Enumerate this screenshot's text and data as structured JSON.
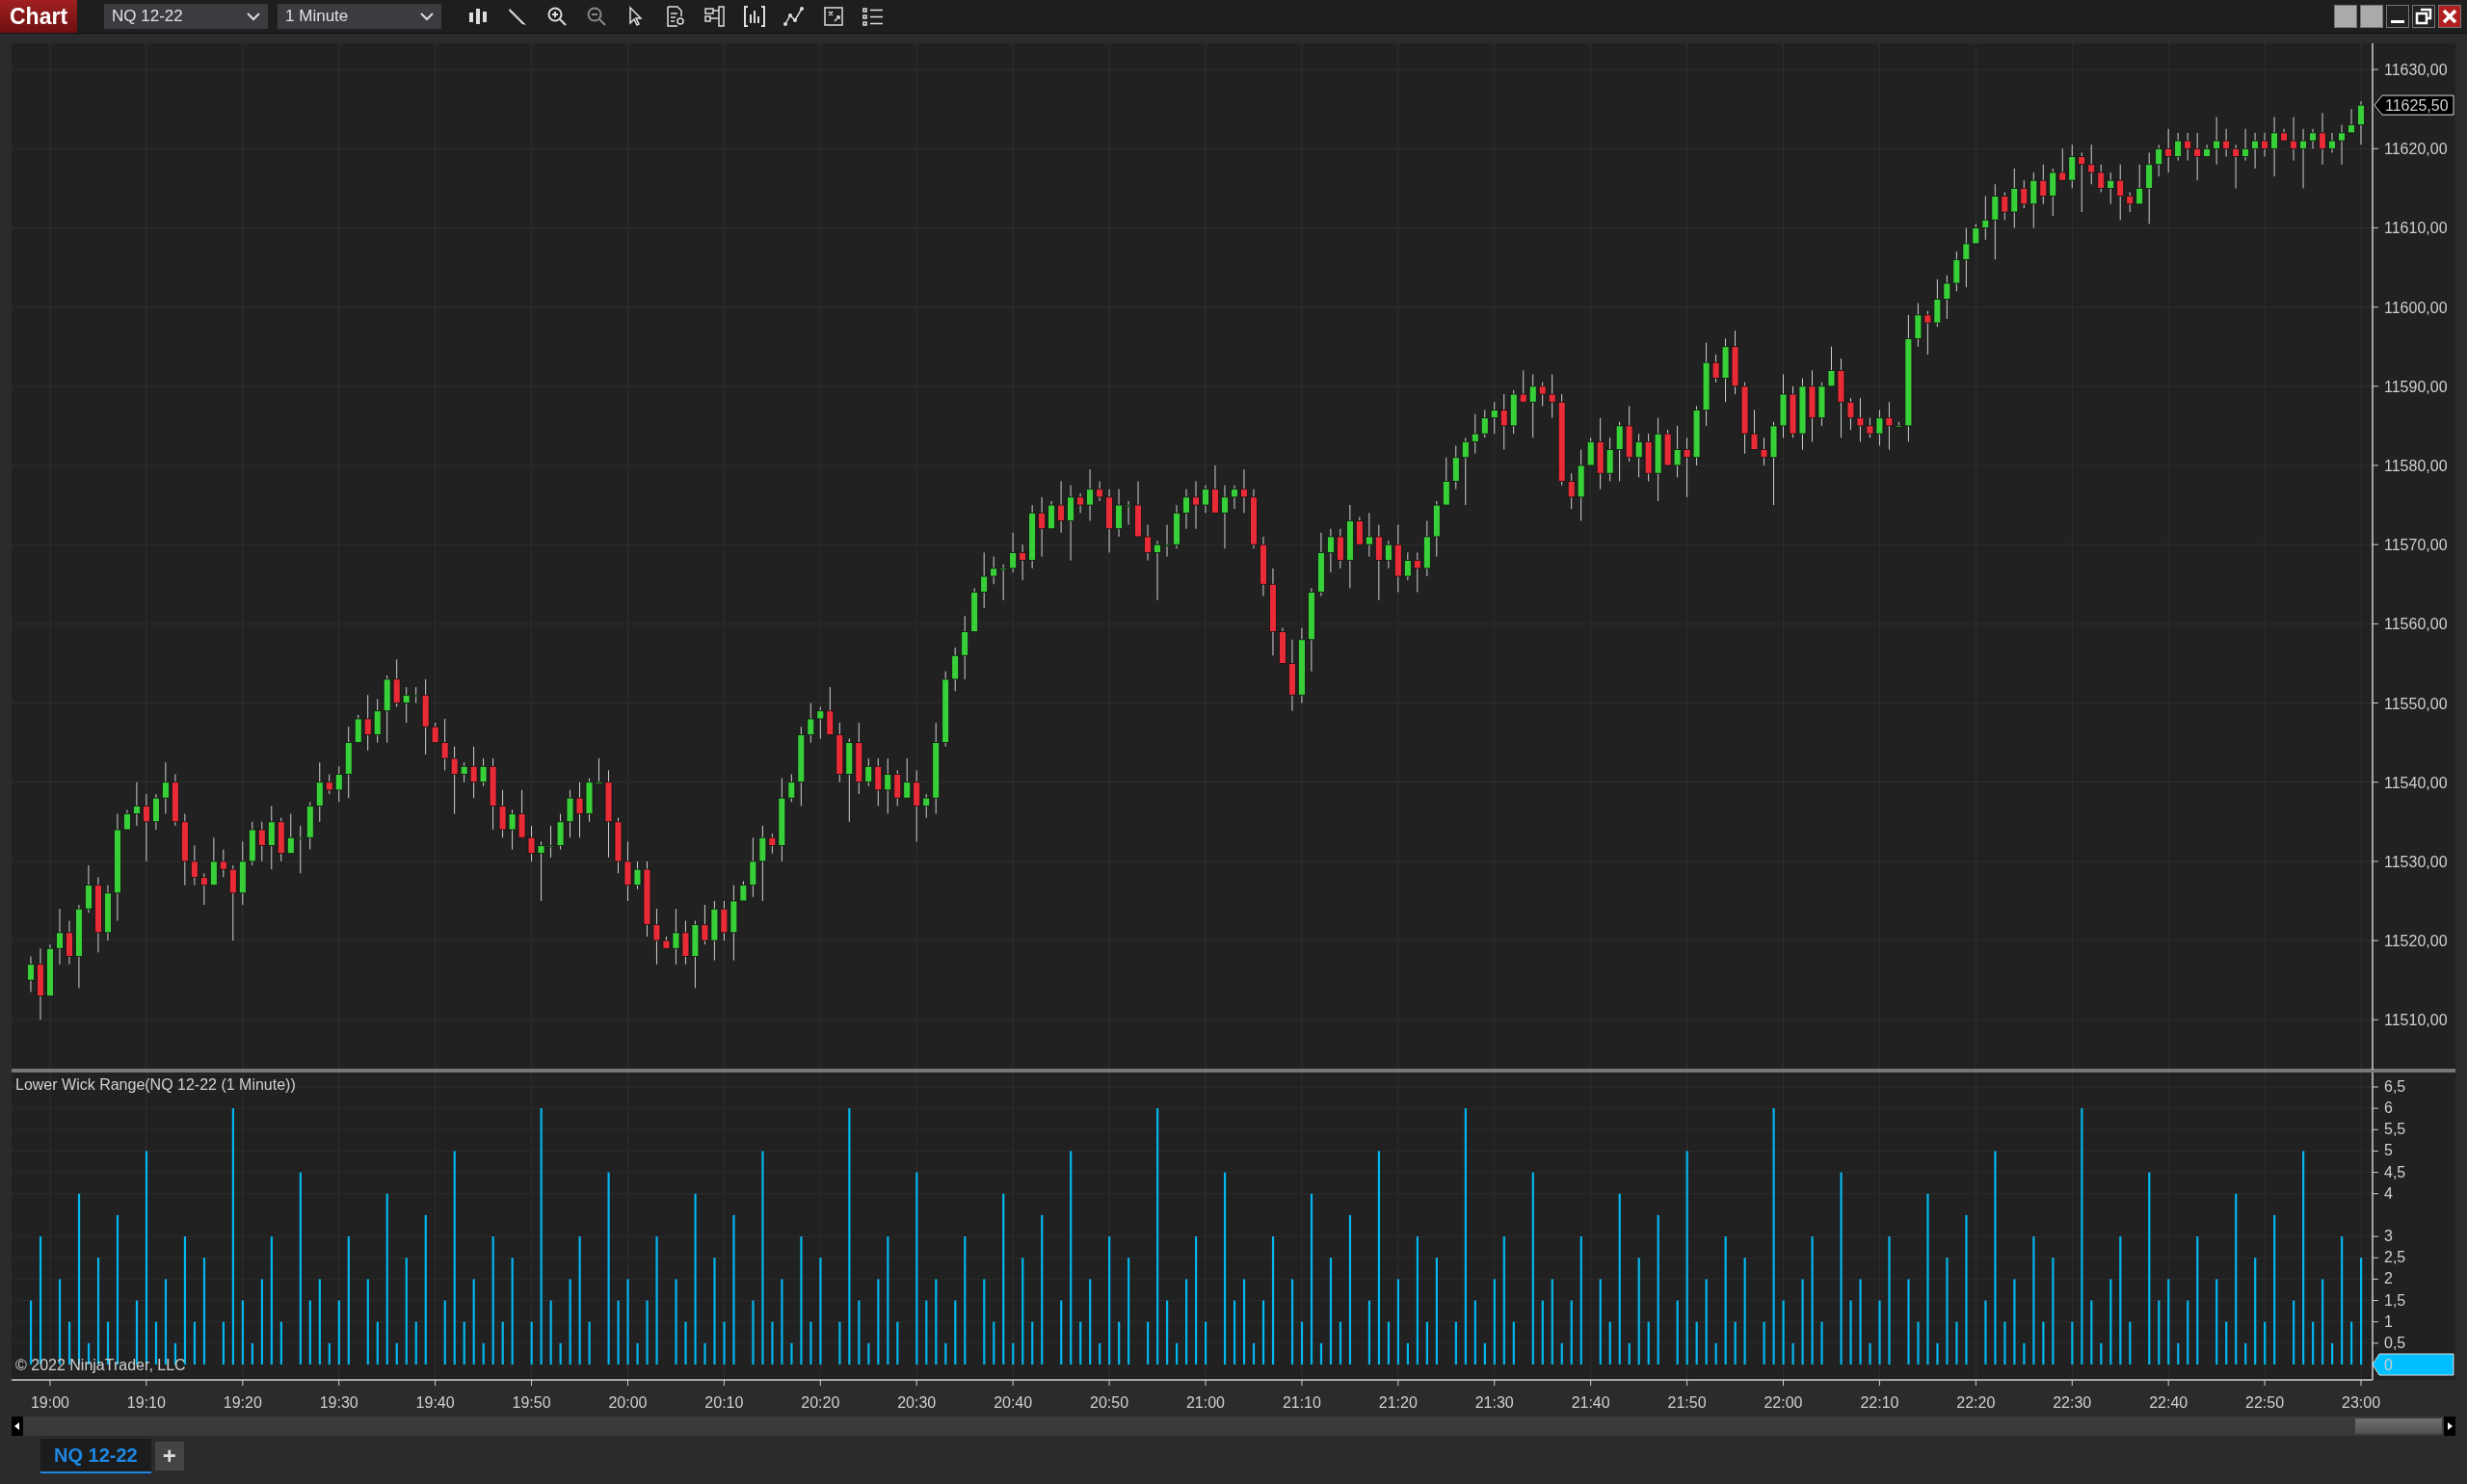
{
  "window": {
    "title": "Chart"
  },
  "toolbar": {
    "instrument": "NQ 12-22",
    "interval": "1 Minute"
  },
  "price_panel": {
    "chart_data": {
      "type": "candlestick",
      "categories": [
        null,
        null,
        null,
        null,
        null,
        null,
        null,
        null,
        null,
        null,
        null,
        null,
        null,
        null,
        null,
        null,
        null,
        null,
        null,
        null,
        null,
        null,
        null,
        null,
        null,
        null,
        null,
        null,
        null,
        null,
        null,
        null,
        null,
        null,
        null,
        null,
        null,
        null,
        null,
        null,
        null,
        null,
        null,
        null,
        null,
        null,
        null,
        null,
        null,
        null,
        null,
        null,
        null,
        null,
        null,
        null,
        null,
        null,
        null,
        null,
        null,
        null,
        null,
        null,
        null,
        null,
        null,
        null,
        null,
        null,
        null,
        null,
        null,
        null,
        null,
        null,
        null,
        null,
        null,
        null,
        null,
        null,
        null,
        null,
        null,
        null,
        null,
        null,
        null,
        null,
        null,
        null,
        null,
        null,
        null,
        null,
        null,
        null,
        null,
        null,
        null,
        null,
        null,
        null,
        null,
        null,
        null,
        null,
        null,
        null,
        null,
        null,
        null,
        null,
        null,
        null,
        null,
        null,
        null,
        null,
        null,
        null,
        null,
        null,
        null,
        null,
        null,
        null,
        null,
        null,
        null,
        null,
        null,
        null,
        null,
        null,
        null,
        null,
        null,
        null,
        null,
        null,
        null,
        null,
        null,
        null,
        null,
        null,
        null,
        null,
        null,
        null,
        null,
        null,
        null,
        null,
        null,
        null,
        null,
        null,
        null,
        null,
        null,
        null,
        null,
        null,
        null,
        null,
        null,
        null,
        null,
        null,
        null,
        null,
        null,
        null,
        null,
        null,
        null,
        null,
        null,
        null,
        null,
        null,
        null,
        null,
        null,
        null,
        null,
        null,
        null,
        null,
        null,
        null,
        null,
        null,
        null,
        null,
        null,
        null,
        null,
        null,
        null,
        null,
        null,
        null,
        null,
        null,
        null,
        null,
        null,
        null,
        null,
        null,
        null,
        null,
        null,
        null,
        null,
        null,
        null,
        null,
        null,
        null,
        null,
        null,
        null,
        null,
        null,
        null,
        null,
        null,
        null,
        null,
        null,
        null,
        null,
        null,
        null,
        null,
        null,
        null,
        null
      ],
      "ohlc": [
        [
          11515,
          11518,
          11513.5,
          11517
        ],
        [
          11517,
          11519,
          11510,
          11513
        ],
        [
          11513,
          11519.5,
          11513,
          11519
        ],
        [
          11519,
          11524,
          11517,
          11521
        ],
        [
          11521,
          11522.5,
          11517,
          11518
        ],
        [
          11518,
          11524.5,
          11514,
          11524
        ],
        [
          11524,
          11529.5,
          11523.5,
          11527
        ],
        [
          11527,
          11528,
          11518.5,
          11521
        ],
        [
          11521,
          11527,
          11520,
          11526
        ],
        [
          11526,
          11536,
          11522.5,
          11534
        ],
        [
          11534,
          11536.5,
          11534,
          11536
        ],
        [
          11536,
          11540,
          11534.5,
          11537
        ],
        [
          11537,
          11538.5,
          11530,
          11535
        ],
        [
          11535,
          11538.5,
          11534,
          11538
        ],
        [
          11538,
          11542.5,
          11536,
          11540
        ],
        [
          11540,
          11541,
          11534.5,
          11535
        ],
        [
          11535,
          11536,
          11527,
          11530
        ],
        [
          11530,
          11532,
          11527,
          11528
        ],
        [
          11528,
          11528.5,
          11524.5,
          11527
        ],
        [
          11527,
          11533,
          11527,
          11530
        ],
        [
          11530,
          11531.5,
          11528,
          11529
        ],
        [
          11529,
          11529.5,
          11520,
          11526
        ],
        [
          11526,
          11532.5,
          11524.5,
          11530
        ],
        [
          11530,
          11535,
          11529.5,
          11534
        ],
        [
          11534,
          11535,
          11530,
          11532
        ],
        [
          11532,
          11537,
          11529,
          11535
        ],
        [
          11535,
          11535.5,
          11530,
          11531
        ],
        [
          11531,
          11536,
          11531,
          11533
        ],
        [
          11533,
          11534.5,
          11528.5,
          11533
        ],
        [
          11533,
          11537.5,
          11531.5,
          11537
        ],
        [
          11537,
          11542.5,
          11535,
          11540
        ],
        [
          11540,
          11541,
          11538.5,
          11539
        ],
        [
          11539,
          11542,
          11537.5,
          11541
        ],
        [
          11541,
          11547,
          11538,
          11545
        ],
        [
          11545,
          11548.5,
          11545,
          11548
        ],
        [
          11548,
          11551,
          11544,
          11546
        ],
        [
          11546,
          11550.5,
          11545,
          11549
        ],
        [
          11549,
          11553.5,
          11545,
          11553
        ],
        [
          11553,
          11555.5,
          11549.5,
          11550
        ],
        [
          11550,
          11552,
          11547.5,
          11551
        ],
        [
          11551,
          11552,
          11550,
          11551
        ],
        [
          11551,
          11553,
          11543.5,
          11547
        ],
        [
          11547,
          11547.5,
          11545,
          11545
        ],
        [
          11545,
          11548,
          11541.5,
          11543
        ],
        [
          11543,
          11544.5,
          11536,
          11541
        ],
        [
          11541,
          11542.5,
          11540,
          11542
        ],
        [
          11542,
          11544.5,
          11538,
          11540
        ],
        [
          11540,
          11543,
          11539.5,
          11542
        ],
        [
          11542,
          11543,
          11534,
          11537
        ],
        [
          11537,
          11539,
          11533,
          11534
        ],
        [
          11534,
          11536.5,
          11531.5,
          11536
        ],
        [
          11536,
          11539,
          11533,
          11533
        ],
        [
          11533,
          11534.5,
          11530,
          11531
        ],
        [
          11531,
          11532.5,
          11525,
          11532
        ],
        [
          11532,
          11534.5,
          11530.5,
          11532
        ],
        [
          11532,
          11536,
          11531.5,
          11535
        ],
        [
          11535,
          11539,
          11533,
          11538
        ],
        [
          11538,
          11540,
          11533,
          11536
        ],
        [
          11536,
          11540.5,
          11535,
          11540
        ],
        [
          11540,
          11543,
          11540,
          11540
        ],
        [
          11540,
          11541.5,
          11530.5,
          11535
        ],
        [
          11535,
          11535.5,
          11528.5,
          11530
        ],
        [
          11530,
          11532.5,
          11525,
          11527
        ],
        [
          11527,
          11530,
          11526.5,
          11529
        ],
        [
          11529,
          11530,
          11520.5,
          11522
        ],
        [
          11522,
          11524,
          11517,
          11520
        ],
        [
          11520,
          11520.5,
          11519,
          11519
        ],
        [
          11519,
          11524,
          11517,
          11521
        ],
        [
          11521,
          11522.5,
          11517,
          11518
        ],
        [
          11518,
          11522.5,
          11514,
          11522
        ],
        [
          11522,
          11524.5,
          11519.5,
          11520
        ],
        [
          11520,
          11525,
          11517.5,
          11524
        ],
        [
          11524,
          11525,
          11520,
          11521
        ],
        [
          11521,
          11527,
          11517.5,
          11525
        ],
        [
          11525,
          11527.5,
          11525,
          11527
        ],
        [
          11527,
          11533,
          11525.5,
          11530
        ],
        [
          11530,
          11534.5,
          11525,
          11533
        ],
        [
          11533,
          11533.5,
          11531,
          11532
        ],
        [
          11532,
          11540.5,
          11530,
          11538
        ],
        [
          11538,
          11541,
          11537.5,
          11540
        ],
        [
          11540,
          11547,
          11537,
          11546
        ],
        [
          11546,
          11550,
          11545,
          11548
        ],
        [
          11548,
          11549.5,
          11545.5,
          11549
        ],
        [
          11549,
          11552,
          11546,
          11546
        ],
        [
          11546,
          11547.5,
          11540,
          11541
        ],
        [
          11541,
          11545.5,
          11535,
          11545
        ],
        [
          11545,
          11547.5,
          11538.5,
          11540
        ],
        [
          11540,
          11543,
          11539.5,
          11542
        ],
        [
          11542,
          11543,
          11537,
          11539
        ],
        [
          11539,
          11543,
          11536,
          11541
        ],
        [
          11541,
          11541.5,
          11537,
          11538
        ],
        [
          11538,
          11543,
          11538,
          11540
        ],
        [
          11540,
          11541.5,
          11532.5,
          11537
        ],
        [
          11537,
          11538.5,
          11535.5,
          11538
        ],
        [
          11538,
          11547.5,
          11536,
          11545
        ],
        [
          11545,
          11554,
          11544.5,
          11553
        ],
        [
          11553,
          11557,
          11551.5,
          11556
        ],
        [
          11556,
          11561,
          11553,
          11559
        ],
        [
          11559,
          11564.5,
          11559,
          11564
        ],
        [
          11564,
          11569,
          11562,
          11566
        ],
        [
          11566,
          11568.5,
          11565,
          11567
        ],
        [
          11567,
          11567.5,
          11563,
          11567
        ],
        [
          11567,
          11571.5,
          11566.5,
          11569
        ],
        [
          11569,
          11570,
          11565.5,
          11568
        ],
        [
          11568,
          11575,
          11567,
          11574
        ],
        [
          11574,
          11576,
          11568.5,
          11572
        ],
        [
          11572,
          11575.5,
          11572,
          11575
        ],
        [
          11575,
          11578,
          11571.5,
          11573
        ],
        [
          11573,
          11577.5,
          11568,
          11576
        ],
        [
          11576,
          11576.5,
          11574,
          11575
        ],
        [
          11575,
          11579.5,
          11573,
          11577
        ],
        [
          11577,
          11578,
          11575.5,
          11576
        ],
        [
          11576,
          11577,
          11569,
          11572
        ],
        [
          11572,
          11577,
          11571,
          11575
        ],
        [
          11575,
          11575.5,
          11572.5,
          11575
        ],
        [
          11575,
          11578,
          11571,
          11571
        ],
        [
          11571,
          11572.5,
          11568,
          11569
        ],
        [
          11569,
          11570.5,
          11563,
          11570
        ],
        [
          11570,
          11572.5,
          11568.5,
          11570
        ],
        [
          11570,
          11575,
          11569.5,
          11574
        ],
        [
          11574,
          11577,
          11572,
          11576
        ],
        [
          11576,
          11578,
          11572,
          11575
        ],
        [
          11575,
          11577.5,
          11574,
          11577
        ],
        [
          11577,
          11580,
          11574,
          11574
        ],
        [
          11574,
          11577.5,
          11569.5,
          11576
        ],
        [
          11576,
          11577.5,
          11574.5,
          11577
        ],
        [
          11577,
          11579.5,
          11574,
          11576
        ],
        [
          11576,
          11577,
          11569.5,
          11570
        ],
        [
          11570,
          11571,
          11563.5,
          11565
        ],
        [
          11565,
          11567,
          11556,
          11559
        ],
        [
          11559,
          11559.5,
          11555,
          11555
        ],
        [
          11555,
          11558,
          11549,
          11551
        ],
        [
          11551,
          11559.5,
          11550,
          11558
        ],
        [
          11558,
          11564.5,
          11554,
          11564
        ],
        [
          11564,
          11571.5,
          11563.5,
          11569
        ],
        [
          11569,
          11572,
          11566.5,
          11571
        ],
        [
          11571,
          11572,
          11567,
          11568
        ],
        [
          11568,
          11575,
          11564.5,
          11573
        ],
        [
          11573,
          11573.5,
          11570,
          11570
        ],
        [
          11570,
          11574,
          11568.5,
          11571
        ],
        [
          11571,
          11572.5,
          11563,
          11568
        ],
        [
          11568,
          11570.5,
          11567,
          11570
        ],
        [
          11570,
          11572.5,
          11564,
          11566
        ],
        [
          11566,
          11569,
          11565.5,
          11568
        ],
        [
          11568,
          11569,
          11564,
          11567
        ],
        [
          11567,
          11573,
          11566,
          11571
        ],
        [
          11571,
          11575.5,
          11568.5,
          11575
        ],
        [
          11575,
          11581,
          11575,
          11578
        ],
        [
          11578,
          11582.5,
          11577,
          11581
        ],
        [
          11581,
          11583.5,
          11575,
          11583
        ],
        [
          11583,
          11586.5,
          11581.5,
          11584
        ],
        [
          11584,
          11587,
          11583.5,
          11586
        ],
        [
          11586,
          11588,
          11584,
          11587
        ],
        [
          11587,
          11589,
          11582,
          11585
        ],
        [
          11585,
          11589.5,
          11584,
          11589
        ],
        [
          11589,
          11592,
          11588,
          11588
        ],
        [
          11588,
          11591.5,
          11583.5,
          11590
        ],
        [
          11590,
          11590.5,
          11587.5,
          11589
        ],
        [
          11589,
          11591.5,
          11586,
          11588
        ],
        [
          11588,
          11589,
          11577.5,
          11578
        ],
        [
          11578,
          11579,
          11574.5,
          11576
        ],
        [
          11576,
          11582,
          11573,
          11580
        ],
        [
          11580,
          11583.5,
          11580,
          11583
        ],
        [
          11583,
          11586,
          11577,
          11579
        ],
        [
          11579,
          11583.5,
          11578,
          11582
        ],
        [
          11582,
          11585.5,
          11578,
          11585
        ],
        [
          11585,
          11587.5,
          11580.5,
          11581
        ],
        [
          11581,
          11584,
          11578.5,
          11583
        ],
        [
          11583,
          11584,
          11578,
          11579
        ],
        [
          11579,
          11586,
          11575.5,
          11584
        ],
        [
          11584,
          11584.5,
          11580,
          11580
        ],
        [
          11580,
          11585,
          11578.5,
          11582
        ],
        [
          11582,
          11583.5,
          11576,
          11581
        ],
        [
          11581,
          11587.5,
          11580,
          11587
        ],
        [
          11587,
          11595.5,
          11585,
          11593
        ],
        [
          11593,
          11594,
          11590.5,
          11591
        ],
        [
          11591,
          11596,
          11588,
          11595
        ],
        [
          11595,
          11597,
          11589,
          11590
        ],
        [
          11590,
          11590.5,
          11581.5,
          11584
        ],
        [
          11584,
          11587,
          11582,
          11582
        ],
        [
          11582,
          11583.5,
          11580,
          11581
        ],
        [
          11581,
          11585.5,
          11575,
          11585
        ],
        [
          11585,
          11591.5,
          11583.5,
          11589
        ],
        [
          11589,
          11590,
          11583.5,
          11584
        ],
        [
          11584,
          11591,
          11582,
          11590
        ],
        [
          11590,
          11592,
          11583,
          11586
        ],
        [
          11586,
          11590.5,
          11585,
          11590
        ],
        [
          11590,
          11595,
          11590,
          11592
        ],
        [
          11592,
          11593.5,
          11583.5,
          11588
        ],
        [
          11588,
          11588.5,
          11584.5,
          11586
        ],
        [
          11586,
          11588.5,
          11583,
          11585
        ],
        [
          11585,
          11586,
          11583.5,
          11584
        ],
        [
          11584,
          11587,
          11582.5,
          11586
        ],
        [
          11586,
          11588,
          11582,
          11585
        ],
        [
          11585,
          11585.5,
          11585,
          11585
        ],
        [
          11585,
          11599,
          11583,
          11596
        ],
        [
          11596,
          11600.5,
          11595,
          11599
        ],
        [
          11599,
          11599.5,
          11594,
          11598
        ],
        [
          11598,
          11603.5,
          11597.5,
          11601
        ],
        [
          11601,
          11604,
          11598.5,
          11603
        ],
        [
          11603,
          11607,
          11602,
          11606
        ],
        [
          11606,
          11610,
          11602.5,
          11608
        ],
        [
          11608,
          11610.5,
          11608,
          11610
        ],
        [
          11610,
          11614,
          11608.5,
          11611
        ],
        [
          11611,
          11615.5,
          11606,
          11614
        ],
        [
          11614,
          11614.5,
          11611,
          11612
        ],
        [
          11612,
          11617.5,
          11610,
          11615
        ],
        [
          11615,
          11616,
          11612.5,
          11613
        ],
        [
          11613,
          11617,
          11610,
          11616
        ],
        [
          11616,
          11618,
          11613,
          11614
        ],
        [
          11614,
          11617.5,
          11611.5,
          11617
        ],
        [
          11617,
          11620,
          11616,
          11616
        ],
        [
          11616,
          11620.5,
          11615,
          11619
        ],
        [
          11619,
          11619.5,
          11612,
          11618
        ],
        [
          11618,
          11620.5,
          11615.5,
          11617
        ],
        [
          11617,
          11618,
          11614.5,
          11615
        ],
        [
          11615,
          11617,
          11613,
          11616
        ],
        [
          11616,
          11618,
          11611,
          11614
        ],
        [
          11614,
          11614.5,
          11612,
          11613
        ],
        [
          11613,
          11618,
          11613,
          11615
        ],
        [
          11615,
          11619.5,
          11610.5,
          11618
        ],
        [
          11618,
          11620.5,
          11616.5,
          11620
        ],
        [
          11620,
          11622.5,
          11617,
          11619
        ],
        [
          11619,
          11622,
          11618.5,
          11621
        ],
        [
          11621,
          11622,
          11618.5,
          11620
        ],
        [
          11620,
          11622,
          11616,
          11619
        ],
        [
          11619,
          11620.5,
          11619,
          11620
        ],
        [
          11620,
          11624,
          11618,
          11621
        ],
        [
          11621,
          11622.5,
          11619,
          11620
        ],
        [
          11620,
          11620.5,
          11615,
          11619
        ],
        [
          11619,
          11622.5,
          11618.5,
          11620
        ],
        [
          11620,
          11622,
          11617.5,
          11621
        ],
        [
          11621,
          11622,
          11619,
          11620
        ],
        [
          11620,
          11624,
          11616.5,
          11622
        ],
        [
          11622,
          11622.5,
          11621,
          11621
        ],
        [
          11621,
          11624,
          11618.5,
          11620
        ],
        [
          11620,
          11622.5,
          11615,
          11621
        ],
        [
          11621,
          11622.5,
          11620,
          11622
        ],
        [
          11622,
          11624.5,
          11618,
          11620
        ],
        [
          11620,
          11622,
          11619.5,
          11621
        ],
        [
          11621,
          11623,
          11618,
          11622
        ],
        [
          11622,
          11625,
          11622,
          11623
        ],
        [
          11623,
          11626,
          11620.5,
          11625.5
        ]
      ],
      "ylim": [
        11503.7,
        11633.3
      ],
      "yticks": [
        {
          "value": 11630,
          "label": "11630,00"
        },
        {
          "value": 11620,
          "label": "11620,00"
        },
        {
          "value": 11610,
          "label": "11610,00"
        },
        {
          "value": 11600,
          "label": "11600,00"
        },
        {
          "value": 11590,
          "label": "11590,00"
        },
        {
          "value": 11580,
          "label": "11580,00"
        },
        {
          "value": 11570,
          "label": "11570,00"
        },
        {
          "value": 11560,
          "label": "11560,00"
        },
        {
          "value": 11550,
          "label": "11550,00"
        },
        {
          "value": 11540,
          "label": "11540,00"
        },
        {
          "value": 11530,
          "label": "11530,00"
        },
        {
          "value": 11520,
          "label": "11520,00"
        },
        {
          "value": 11510,
          "label": "11510,00"
        }
      ]
    },
    "last_price": "11625,50"
  },
  "indicator_panel": {
    "chart_data": {
      "type": "bar",
      "title": "Lower Wick Range(NQ 12-22 (1 Minute))",
      "categories": [
        null,
        null,
        "19:00",
        null,
        null,
        null,
        null,
        null,
        null,
        null,
        null,
        null,
        "19:10",
        null,
        null,
        null,
        null,
        null,
        null,
        null,
        null,
        null,
        "19:20",
        null,
        null,
        null,
        null,
        null,
        null,
        null,
        null,
        null,
        "19:30",
        null,
        null,
        null,
        null,
        null,
        null,
        null,
        null,
        null,
        "19:40",
        null,
        null,
        null,
        null,
        null,
        null,
        null,
        null,
        null,
        "19:50",
        null,
        null,
        null,
        null,
        null,
        null,
        null,
        null,
        null,
        "20:00",
        null,
        null,
        null,
        null,
        null,
        null,
        null,
        null,
        null,
        "20:10",
        null,
        null,
        null,
        null,
        null,
        null,
        null,
        null,
        null,
        "20:20",
        null,
        null,
        null,
        null,
        null,
        null,
        null,
        null,
        null,
        "20:30",
        null,
        null,
        null,
        null,
        null,
        null,
        null,
        null,
        null,
        "20:40",
        null,
        null,
        null,
        null,
        null,
        null,
        null,
        null,
        null,
        "20:50",
        null,
        null,
        null,
        null,
        null,
        null,
        null,
        null,
        null,
        "21:00",
        null,
        null,
        null,
        null,
        null,
        null,
        null,
        null,
        null,
        "21:10",
        null,
        null,
        null,
        null,
        null,
        null,
        null,
        null,
        null,
        "21:20",
        null,
        null,
        null,
        null,
        null,
        null,
        null,
        null,
        null,
        "21:30",
        null,
        null,
        null,
        null,
        null,
        null,
        null,
        null,
        null,
        "21:40",
        null,
        null,
        null,
        null,
        null,
        null,
        null,
        null,
        null,
        "21:50",
        null,
        null,
        null,
        null,
        null,
        null,
        null,
        null,
        null,
        "22:00",
        null,
        null,
        null,
        null,
        null,
        null,
        null,
        null,
        null,
        "22:10",
        null,
        null,
        null,
        null,
        null,
        null,
        null,
        null,
        null,
        "22:20",
        null,
        null,
        null,
        null,
        null,
        null,
        null,
        null,
        null,
        "22:30",
        null,
        null,
        null,
        null,
        null,
        null,
        null,
        null,
        null,
        "22:40",
        null,
        null,
        null,
        null,
        null,
        null,
        null,
        null,
        null,
        "22:50",
        null,
        null,
        null,
        null,
        null,
        null,
        null,
        null,
        null,
        "23:00"
      ],
      "values": [
        1.5,
        3,
        0,
        2,
        1,
        4,
        0.5,
        2.5,
        1,
        3.5,
        0,
        1.5,
        5,
        1,
        2,
        0.5,
        3,
        1,
        2.5,
        0,
        1,
        6,
        1.5,
        0.5,
        2,
        3,
        1,
        0,
        4.5,
        1.5,
        2,
        0.5,
        1.5,
        3,
        0,
        2,
        1,
        4,
        0.5,
        2.5,
        1,
        3.5,
        0,
        1.5,
        5,
        1,
        2,
        0.5,
        3,
        1,
        2.5,
        0,
        1,
        6,
        1.5,
        0.5,
        2,
        3,
        1,
        0,
        4.5,
        1.5,
        2,
        0.5,
        1.5,
        3,
        0,
        2,
        1,
        4,
        0.5,
        2.5,
        1,
        3.5,
        0,
        1.5,
        5,
        1,
        2,
        0.5,
        3,
        1,
        2.5,
        0,
        1,
        6,
        1.5,
        0.5,
        2,
        3,
        1,
        0,
        4.5,
        1.5,
        2,
        0.5,
        1.5,
        3,
        0,
        2,
        1,
        4,
        0.5,
        2.5,
        1,
        3.5,
        0,
        1.5,
        5,
        1,
        2,
        0.5,
        3,
        1,
        2.5,
        0,
        1,
        6,
        1.5,
        0.5,
        2,
        3,
        1,
        0,
        4.5,
        1.5,
        2,
        0.5,
        1.5,
        3,
        0,
        2,
        1,
        4,
        0.5,
        2.5,
        1,
        3.5,
        0,
        1.5,
        5,
        1,
        2,
        0.5,
        3,
        1,
        2.5,
        0,
        1,
        6,
        1.5,
        0.5,
        2,
        3,
        1,
        0,
        4.5,
        1.5,
        2,
        0.5,
        1.5,
        3,
        0,
        2,
        1,
        4,
        0.5,
        2.5,
        1,
        3.5,
        0,
        1.5,
        5,
        1,
        2,
        0.5,
        3,
        1,
        2.5,
        0,
        1,
        6,
        1.5,
        0.5,
        2,
        3,
        1,
        0,
        4.5,
        1.5,
        2,
        0.5,
        1.5,
        3,
        0,
        2,
        1,
        4,
        0.5,
        2.5,
        1,
        3.5,
        0,
        1.5,
        5,
        1,
        2,
        0.5,
        3,
        1,
        2.5,
        0,
        1,
        6,
        1.5,
        0.5,
        2,
        3,
        1,
        0,
        4.5,
        1.5,
        2,
        0.5,
        1.5,
        3,
        0,
        2,
        1,
        4,
        0.5,
        2.5,
        1,
        3.5,
        0,
        1.5,
        5,
        1,
        2,
        0.5,
        3,
        1,
        2.5
      ],
      "ylim": [
        -0.36,
        6.86
      ],
      "yticks": [
        {
          "value": 6.5,
          "label": "6,5"
        },
        {
          "value": 6,
          "label": "6"
        },
        {
          "value": 5.5,
          "label": "5,5"
        },
        {
          "value": 5,
          "label": "5"
        },
        {
          "value": 4.5,
          "label": "4,5"
        },
        {
          "value": 4,
          "label": "4"
        },
        {
          "value": 3,
          "label": "3"
        },
        {
          "value": 2.5,
          "label": "2,5"
        },
        {
          "value": 2,
          "label": "2"
        },
        {
          "value": 1.5,
          "label": "1,5"
        },
        {
          "value": 1,
          "label": "1"
        },
        {
          "value": 0.5,
          "label": "0,5"
        }
      ]
    },
    "current_value": "0"
  },
  "copyright": "© 2022 NinjaTrader, LLC",
  "tabs": [
    {
      "label": "NQ 12-22",
      "selected": true
    }
  ],
  "add_tab": "+"
}
